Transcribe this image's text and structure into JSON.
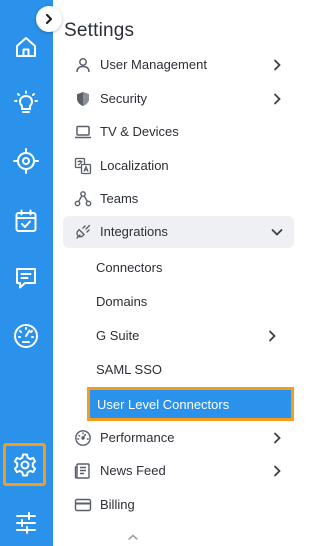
{
  "rail": {
    "items": [
      {
        "name": "home-icon"
      },
      {
        "name": "lightbulb-icon"
      },
      {
        "name": "target-icon"
      },
      {
        "name": "calendar-check-icon"
      },
      {
        "name": "chat-icon"
      },
      {
        "name": "gauge-icon"
      },
      {
        "name": "gear-icon",
        "selected": true
      },
      {
        "name": "sliders-icon"
      }
    ],
    "background": "#2a92ea",
    "highlight_color": "#f59c1c"
  },
  "settings": {
    "title": "Settings",
    "items": [
      {
        "label": "User Management",
        "icon": "user-icon",
        "chevron": "right"
      },
      {
        "label": "Security",
        "icon": "shield-icon",
        "chevron": "right"
      },
      {
        "label": "TV & Devices",
        "icon": "laptop-icon"
      },
      {
        "label": "Localization",
        "icon": "translate-icon"
      },
      {
        "label": "Teams",
        "icon": "team-icon"
      },
      {
        "label": "Integrations",
        "icon": "plug-icon",
        "chevron": "down",
        "expanded": true
      },
      {
        "label": "Performance",
        "icon": "performance-icon",
        "chevron": "right"
      },
      {
        "label": "News Feed",
        "icon": "newspaper-icon",
        "chevron": "right"
      },
      {
        "label": "Billing",
        "icon": "credit-card-icon"
      }
    ],
    "integrations_subitems": [
      {
        "label": "Connectors"
      },
      {
        "label": "Domains"
      },
      {
        "label": "G Suite",
        "chevron": "right"
      },
      {
        "label": "SAML SSO"
      },
      {
        "label": "User Level Connectors",
        "active": true
      }
    ]
  }
}
